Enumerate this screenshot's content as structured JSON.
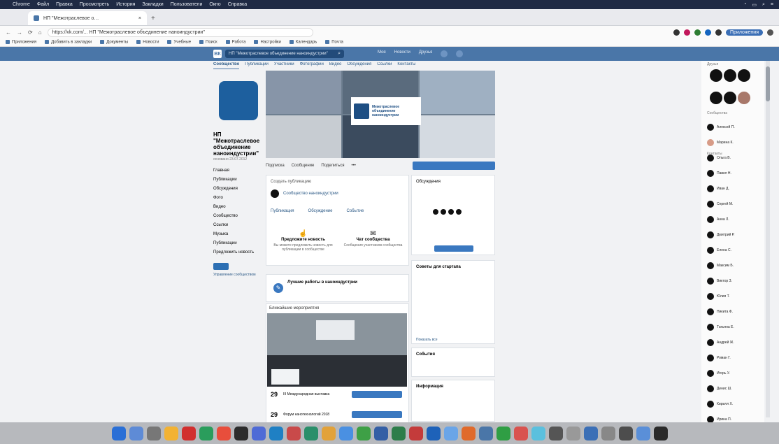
{
  "menubar": {
    "items": [
      "Chrome",
      "Файл",
      "Правка",
      "Просмотреть",
      "История",
      "Закладки",
      "Пользователи",
      "Окно",
      "Справка"
    ]
  },
  "browser": {
    "tab_title": "НП \"Межотраслевое о…",
    "url": "https://vk.com/... НП \"Межотраслевое объединение наноиндустрии\"",
    "profile": "Приложения",
    "bookmarks": [
      "Приложения",
      "Добавить в закладки",
      "Документы",
      "Новости",
      "Учебные",
      "Поиск",
      "Работа",
      "Настройки",
      "Календарь",
      "Почта"
    ]
  },
  "vk": {
    "logo": "ВК",
    "search_placeholder": "НП \"Межотраслевое объединение наноиндустрии\"",
    "search_icon": "⌕",
    "nav": [
      "Моя",
      "Новости",
      "Друзья"
    ],
    "subtabs": [
      "Сообщество",
      "Публикации",
      "Участники",
      "Фотографии",
      "Видео",
      "Обсуждения",
      "Ссылки",
      "Контакты"
    ]
  },
  "group": {
    "name": "НП \"Межотраслевое объединение наноиндустрии\"",
    "date": "основано 23.07.2012",
    "menu": [
      "Главная",
      "Публикации",
      "Обсуждения",
      "Фото",
      "Видео",
      "Сообщество",
      "Ссылки",
      "Музыка",
      "Публикации",
      "Предложить новость"
    ],
    "subscribe_label": "",
    "leftsmall": "Управление сообществом"
  },
  "cover_logo_text": [
    "Межотраслевое",
    "объединение",
    "наноиндустрии"
  ],
  "actions": [
    "Подписка",
    "Сообщение",
    "Поделиться"
  ],
  "feed": {
    "write_post": "Создать публикацию",
    "author": "Сообщество наноиндустрии",
    "tags": [
      "Публикация",
      "Обсуждение",
      "Событие"
    ],
    "suggest_title": "Предложите новость",
    "suggest_text": "Вы можете предложить новость для публикации в сообществе",
    "chat_title": "Чат сообщества",
    "chat_text": "Сообщения участников сообщества",
    "highlight": "Лучшие работы в наноиндустрии",
    "event_caption": "Ближайшие мероприятия",
    "event1_date": "29",
    "event1_title": "III Международная выставка",
    "event2_date": "29",
    "event2_title": "Форум нанотехнологий 2018"
  },
  "rightcol": {
    "title": "Обсуждения",
    "news_title": "Советы для стартапа",
    "events_title": "События",
    "info_title": "Информация",
    "footer": "Показать все"
  },
  "sidebar": {
    "friends_label": "Друзья",
    "online_label": "Контакты",
    "groups_label": "Сообщества",
    "names": [
      "Алексей П.",
      "Марина К.",
      "Ольга В.",
      "Павел Н.",
      "Иван Д.",
      "Сергей М.",
      "Анна Л.",
      "Дмитрий Р.",
      "Елена С.",
      "Максим Б.",
      "Виктор З.",
      "Юлия Т.",
      "Никита Ф.",
      "Татьяна Е.",
      "Андрей Ж.",
      "Роман Г.",
      "Игорь У.",
      "Денис Ш.",
      "Кирилл Х.",
      "Ирина П."
    ]
  },
  "colors": {
    "accent": "#4a76a8",
    "button": "#3a78c0",
    "avatar": "#1d5f9e"
  }
}
